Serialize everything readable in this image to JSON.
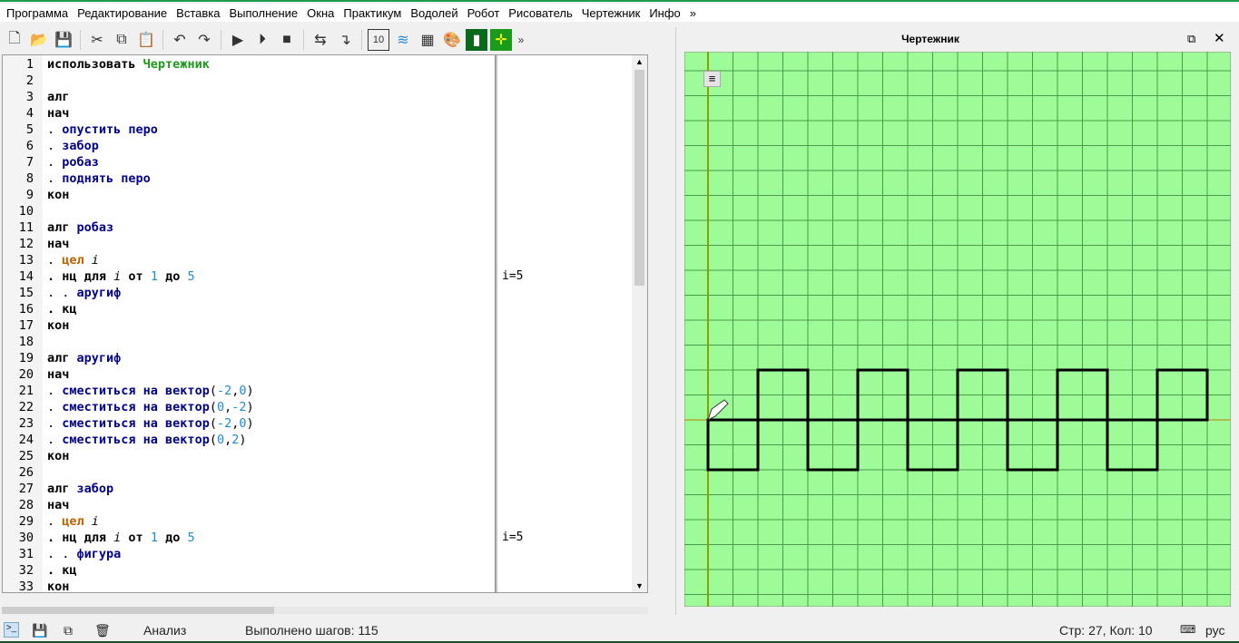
{
  "menu": [
    "Программа",
    "Редактирование",
    "Вставка",
    "Выполнение",
    "Окна",
    "Практикум",
    "Водолей",
    "Робот",
    "Рисователь",
    "Чертежник",
    "Инфо",
    "»"
  ],
  "toolbar": [
    {
      "icon": "new-file-icon",
      "g": "🗋"
    },
    {
      "icon": "open-folder-icon",
      "g": "📂"
    },
    {
      "icon": "save-icon",
      "g": "💾"
    },
    null,
    {
      "icon": "cut-icon",
      "g": "✂"
    },
    {
      "icon": "copy-icon",
      "g": "⧉"
    },
    {
      "icon": "paste-icon",
      "g": "📋"
    },
    null,
    {
      "icon": "undo-icon",
      "g": "↶"
    },
    {
      "icon": "redo-icon",
      "g": "↷"
    },
    null,
    {
      "icon": "run-icon",
      "g": "▶"
    },
    {
      "icon": "run-step-icon",
      "g": "⏵"
    },
    {
      "icon": "stop-icon",
      "g": "■"
    },
    null,
    {
      "icon": "step-over-icon",
      "g": "⇆"
    },
    {
      "icon": "step-into-icon",
      "g": "↴"
    },
    null,
    {
      "icon": "calculator-icon",
      "g": "10"
    },
    {
      "icon": "vodoley-icon",
      "g": "≋"
    },
    {
      "icon": "robot-grid-icon",
      "g": "▦"
    },
    {
      "icon": "painter-icon",
      "g": "🎨"
    },
    {
      "icon": "turtle-icon",
      "g": "▮"
    },
    {
      "icon": "draftsman-icon",
      "g": "✛"
    },
    {
      "icon": "more-icon",
      "g": "»"
    }
  ],
  "code": [
    [
      [
        "использовать ",
        "k"
      ],
      [
        "Чертежник",
        "g"
      ]
    ],
    [],
    [
      [
        "алг",
        "k"
      ]
    ],
    [
      [
        "нач",
        "k"
      ]
    ],
    [
      [
        ". ",
        "p"
      ],
      [
        "опустить перо",
        "f"
      ]
    ],
    [
      [
        ". ",
        "p"
      ],
      [
        "забор",
        "f"
      ]
    ],
    [
      [
        ". ",
        "p"
      ],
      [
        "робаз",
        "f"
      ]
    ],
    [
      [
        ". ",
        "p"
      ],
      [
        "поднять перо",
        "f"
      ]
    ],
    [
      [
        "кон",
        "k"
      ]
    ],
    [],
    [
      [
        "алг ",
        "k"
      ],
      [
        "робаз",
        "f"
      ]
    ],
    [
      [
        "нач",
        "k"
      ]
    ],
    [
      [
        ". ",
        "p"
      ],
      [
        "цел ",
        "t"
      ],
      [
        "i",
        "v"
      ]
    ],
    [
      [
        ". нц для ",
        "k"
      ],
      [
        "i",
        "v"
      ],
      [
        " от ",
        "k"
      ],
      [
        "1",
        "n"
      ],
      [
        " до ",
        "k"
      ],
      [
        "5",
        "n"
      ]
    ],
    [
      [
        ". . ",
        "p"
      ],
      [
        "аругиф",
        "f"
      ]
    ],
    [
      [
        ". кц",
        "k"
      ]
    ],
    [
      [
        "кон",
        "k"
      ]
    ],
    [],
    [
      [
        "алг ",
        "k"
      ],
      [
        "аругиф",
        "f"
      ]
    ],
    [
      [
        "нач",
        "k"
      ]
    ],
    [
      [
        ". ",
        "p"
      ],
      [
        "сместиться на вектор",
        "f"
      ],
      [
        "(",
        "p"
      ],
      [
        "-2",
        "n"
      ],
      [
        ",",
        "p"
      ],
      [
        "0",
        "n"
      ],
      [
        ")",
        "p"
      ]
    ],
    [
      [
        ". ",
        "p"
      ],
      [
        "сместиться на вектор",
        "f"
      ],
      [
        "(",
        "p"
      ],
      [
        "0",
        "n"
      ],
      [
        ",",
        "p"
      ],
      [
        "-2",
        "n"
      ],
      [
        ")",
        "p"
      ]
    ],
    [
      [
        ". ",
        "p"
      ],
      [
        "сместиться на вектор",
        "f"
      ],
      [
        "(",
        "p"
      ],
      [
        "-2",
        "n"
      ],
      [
        ",",
        "p"
      ],
      [
        "0",
        "n"
      ],
      [
        ")",
        "p"
      ]
    ],
    [
      [
        ". ",
        "p"
      ],
      [
        "сместиться на вектор",
        "f"
      ],
      [
        "(",
        "p"
      ],
      [
        "0",
        "n"
      ],
      [
        ",",
        "p"
      ],
      [
        "2",
        "n"
      ],
      [
        ")",
        "p"
      ]
    ],
    [
      [
        "кон",
        "k"
      ]
    ],
    [],
    [
      [
        "алг ",
        "k"
      ],
      [
        "забор",
        "f"
      ]
    ],
    [
      [
        "нач",
        "k"
      ]
    ],
    [
      [
        ". ",
        "p"
      ],
      [
        "цел ",
        "t"
      ],
      [
        "i",
        "v"
      ]
    ],
    [
      [
        ". нц для ",
        "k"
      ],
      [
        "i",
        "v"
      ],
      [
        " от ",
        "k"
      ],
      [
        "1",
        "n"
      ],
      [
        " до ",
        "k"
      ],
      [
        "5",
        "n"
      ]
    ],
    [
      [
        ". . ",
        "p"
      ],
      [
        "фигура",
        "f"
      ]
    ],
    [
      [
        ". кц",
        "k"
      ]
    ],
    [
      [
        "кон",
        "k"
      ]
    ]
  ],
  "margin_values": {
    "14": "i=5",
    "30": "i=5"
  },
  "panel": {
    "title": "Чертежник"
  },
  "drawing": {
    "unit_origin": [
      0,
      0
    ],
    "up_squares_x": [
      2,
      6,
      10,
      14,
      18
    ],
    "down_squares_x": [
      0,
      4,
      8,
      12,
      16
    ],
    "size": 2,
    "baseline": [
      0,
      20
    ]
  },
  "status": {
    "analysis": "Анализ",
    "steps": "Выполнено шагов: 115",
    "position": "Стр: 27, Кол: 10",
    "lang": "рус"
  }
}
